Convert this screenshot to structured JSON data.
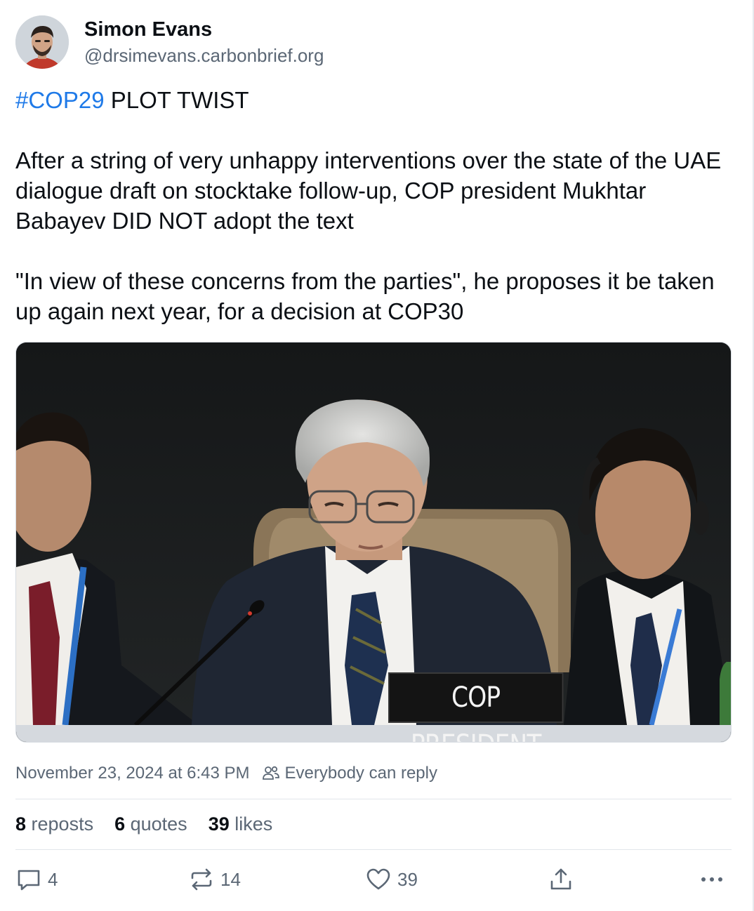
{
  "author": {
    "display_name": "Simon Evans",
    "handle": "@drsimevans.carbonbrief.org"
  },
  "post": {
    "hashtag": "#COP29",
    "headline_rest": " PLOT TWIST",
    "paragraph_1": "After a string of very unhappy interventions over the state of the UAE dialogue draft on stocktake follow-up, COP president Mukhtar Babayev DID NOT adopt the text",
    "paragraph_2": "\"In view of these concerns from the parties\", he proposes it be taken up again next year, for a decision at COP30"
  },
  "media": {
    "nameplate_text": "COP PRESIDENT"
  },
  "meta": {
    "timestamp": "November 23, 2024 at 6:43 PM",
    "reply_setting": "Everybody can reply"
  },
  "stats": {
    "reposts_count": "8",
    "reposts_label": " reposts",
    "quotes_count": "6",
    "quotes_label": " quotes",
    "likes_count": "39",
    "likes_label": " likes"
  },
  "actions": {
    "reply_count": "4",
    "repost_count": "14",
    "like_count": "39"
  },
  "icons": {
    "reply": "speech-bubble-icon",
    "repost": "repost-arrows-icon",
    "like": "heart-icon",
    "share": "share-icon",
    "more": "ellipsis-icon",
    "reply_setting": "people-icon"
  },
  "colors": {
    "hashtag": "#1f7ae8",
    "muted_text": "#5b6775",
    "primary_text": "#0b0f14"
  }
}
